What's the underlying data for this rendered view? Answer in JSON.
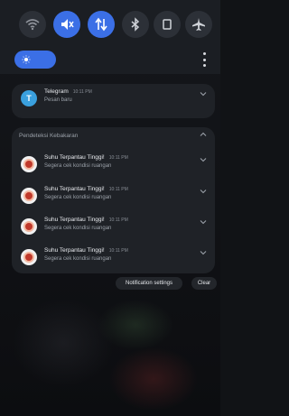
{
  "quick_settings": {
    "toggles": [
      {
        "icon": "wifi-icon",
        "active": false
      },
      {
        "icon": "mute-icon",
        "active": true
      },
      {
        "icon": "data-transfer-icon",
        "active": true
      },
      {
        "icon": "bluetooth-icon",
        "active": false
      },
      {
        "icon": "screen-rotation-icon",
        "active": false
      },
      {
        "icon": "airplane-icon",
        "active": false
      }
    ],
    "brightness_icon": "sun-icon",
    "accent_color": "#3b6fe6"
  },
  "telegram": {
    "app_name": "Telegram",
    "time": "10:11 PM",
    "message": "Pesan baru"
  },
  "fire_group": {
    "title": "Pendeteksi Kebakaran",
    "items": [
      {
        "title": "Suhu Terpantau Tinggi!",
        "time": "10:11 PM",
        "body": "Segera cek kondisi ruangan"
      },
      {
        "title": "Suhu Terpantau Tinggi!",
        "time": "10:11 PM",
        "body": "Segera cek kondisi ruangan"
      },
      {
        "title": "Suhu Terpantau Tinggi!",
        "time": "10:11 PM",
        "body": "Segera cek kondisi ruangan"
      },
      {
        "title": "Suhu Terpantau Tinggi!",
        "time": "10:11 PM",
        "body": "Segera cek kondisi ruangan"
      }
    ]
  },
  "actions": {
    "settings_label": "Notification settings",
    "clear_label": "Clear"
  }
}
